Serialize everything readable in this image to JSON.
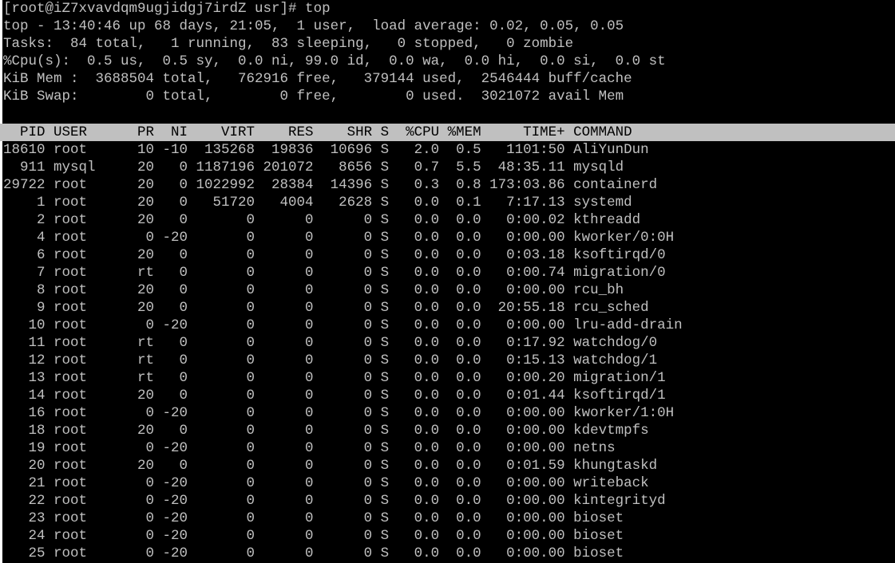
{
  "terminal": {
    "prompt": "[root@iZ7xvavdqm9ugjidgj7irdZ usr]# top",
    "summary": [
      "top - 13:40:46 up 68 days, 21:05,  1 user,  load average: 0.02, 0.05, 0.05",
      "Tasks:  84 total,   1 running,  83 sleeping,   0 stopped,   0 zombie",
      "%Cpu(s):  0.5 us,  0.5 sy,  0.0 ni, 99.0 id,  0.0 wa,  0.0 hi,  0.0 si,  0.0 st",
      "KiB Mem :  3688504 total,   762916 free,   379144 used,  2546444 buff/cache",
      "KiB Swap:        0 total,        0 free,        0 used.  3021072 avail Mem"
    ],
    "header": "  PID USER      PR  NI    VIRT    RES    SHR S  %CPU %MEM     TIME+ COMMAND",
    "processes": [
      "18610 root      10 -10  135268  19836  10696 S   2.0  0.5   1101:50 AliYunDun",
      "  911 mysql     20   0 1187196 201072   8656 S   0.7  5.5  48:35.11 mysqld",
      "29722 root      20   0 1022992  28384  14396 S   0.3  0.8 173:03.86 containerd",
      "    1 root      20   0   51720   4004   2628 S   0.0  0.1   7:17.13 systemd",
      "    2 root      20   0       0      0      0 S   0.0  0.0   0:00.02 kthreadd",
      "    4 root       0 -20       0      0      0 S   0.0  0.0   0:00.00 kworker/0:0H",
      "    6 root      20   0       0      0      0 S   0.0  0.0   0:03.18 ksoftirqd/0",
      "    7 root      rt   0       0      0      0 S   0.0  0.0   0:00.74 migration/0",
      "    8 root      20   0       0      0      0 S   0.0  0.0   0:00.00 rcu_bh",
      "    9 root      20   0       0      0      0 S   0.0  0.0  20:55.18 rcu_sched",
      "   10 root       0 -20       0      0      0 S   0.0  0.0   0:00.00 lru-add-drain",
      "   11 root      rt   0       0      0      0 S   0.0  0.0   0:17.92 watchdog/0",
      "   12 root      rt   0       0      0      0 S   0.0  0.0   0:15.13 watchdog/1",
      "   13 root      rt   0       0      0      0 S   0.0  0.0   0:00.20 migration/1",
      "   14 root      20   0       0      0      0 S   0.0  0.0   0:01.44 ksoftirqd/1",
      "   16 root       0 -20       0      0      0 S   0.0  0.0   0:00.00 kworker/1:0H",
      "   18 root      20   0       0      0      0 S   0.0  0.0   0:00.00 kdevtmpfs",
      "   19 root       0 -20       0      0      0 S   0.0  0.0   0:00.00 netns",
      "   20 root      20   0       0      0      0 S   0.0  0.0   0:01.59 khungtaskd",
      "   21 root       0 -20       0      0      0 S   0.0  0.0   0:00.00 writeback",
      "   22 root       0 -20       0      0      0 S   0.0  0.0   0:00.00 kintegrityd",
      "   23 root       0 -20       0      0      0 S   0.0  0.0   0:00.00 bioset",
      "   24 root       0 -20       0      0      0 S   0.0  0.0   0:00.00 bioset",
      "   25 root       0 -20       0      0      0 S   0.0  0.0   0:00.00 bioset"
    ],
    "colors": {
      "background": "#000000",
      "text": "#c0c0c0",
      "header_bg": "#c0c0c0",
      "header_text": "#000000"
    }
  }
}
